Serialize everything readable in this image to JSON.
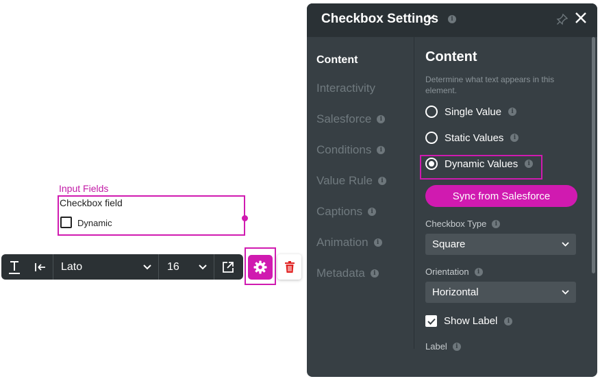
{
  "widget": {
    "caption": "Input Fields",
    "title": "Checkbox field",
    "checkbox_label": "Dynamic"
  },
  "toolbar": {
    "font": "Lato",
    "size": "16",
    "icons": [
      "text-style-icon",
      "indent-icon",
      "chevron-down-icon",
      "external-link-icon",
      "gear-icon",
      "trash-icon"
    ]
  },
  "panel": {
    "title": "Checkbox Settings",
    "nav": [
      {
        "label": "Content",
        "active": true,
        "info": false
      },
      {
        "label": "Interactivity",
        "active": false,
        "info": false
      },
      {
        "label": "Salesforce",
        "active": false,
        "info": true
      },
      {
        "label": "Conditions",
        "active": false,
        "info": true
      },
      {
        "label": "Value Rule",
        "active": false,
        "info": true
      },
      {
        "label": "Captions",
        "active": false,
        "info": true
      },
      {
        "label": "Animation",
        "active": false,
        "info": true
      },
      {
        "label": "Metadata",
        "active": false,
        "info": true
      }
    ],
    "content": {
      "title": "Content",
      "description": "Determine what text appears in this element.",
      "radios": [
        {
          "label": "Single Value",
          "selected": false
        },
        {
          "label": "Static Values",
          "selected": false
        },
        {
          "label": "Dynamic Values",
          "selected": true
        }
      ],
      "sync_button": "Sync from Salesforce",
      "checkbox_type_label": "Checkbox Type",
      "checkbox_type_value": "Square",
      "orientation_label": "Orientation",
      "orientation_value": "Horizontal",
      "show_label": "Show Label",
      "show_label_checked": true,
      "label_label": "Label"
    }
  },
  "colors": {
    "accent": "#d01ab0",
    "panel_bg": "#373f44",
    "header_bg": "#2a3135",
    "toolbar_bg": "#2b3134"
  }
}
